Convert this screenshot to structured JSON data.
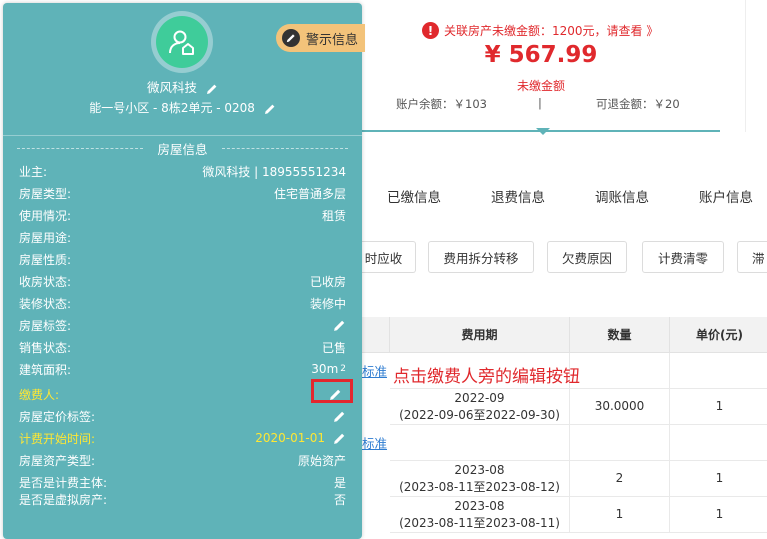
{
  "summary": {
    "notice": "关联房产未缴金额：1200元，请查看 》",
    "amount": "¥ 567.99",
    "amount_label": "未缴金额",
    "balance": "账户余额：￥103",
    "separator": "|",
    "refundable": "可退金额：￥20"
  },
  "tabs": [
    "已缴信息",
    "退费信息",
    "调账信息",
    "账户信息"
  ],
  "buttons": [
    "时应收",
    "费用拆分转移",
    "欠费原因",
    "计费清零",
    "滞"
  ],
  "table": {
    "headers": [
      "费用期",
      "数量",
      "单价(元)"
    ],
    "link_text": "标准",
    "rows": [
      {
        "period": "2022-09",
        "range": "(2022-09-06至2022-09-30)",
        "qty": "30.0000",
        "price": "1"
      },
      {
        "period": "2023-08",
        "range": "(2023-08-11至2023-08-12)",
        "qty": "2",
        "price": "1"
      },
      {
        "period": "2023-08",
        "range": "(2023-08-11至2023-08-11)",
        "qty": "1",
        "price": "1"
      }
    ]
  },
  "annotation": "点击缴费人旁的编辑按钮",
  "panel": {
    "owner": "微风科技",
    "address": "能一号小区 - 8栋2单元 - 0208",
    "warn_label": "警示信息",
    "section_title": "房屋信息",
    "fields": [
      {
        "label": "业主:",
        "value": "微风科技 | 18955551234"
      },
      {
        "label": "房屋类型:",
        "value": "住宅普通多层"
      },
      {
        "label": "使用情况:",
        "value": "租赁"
      },
      {
        "label": "房屋用途:",
        "value": ""
      },
      {
        "label": "房屋性质:",
        "value": ""
      },
      {
        "label": "收房状态:",
        "value": "已收房"
      },
      {
        "label": "装修状态:",
        "value": "装修中"
      },
      {
        "label": "房屋标签:",
        "value": ""
      },
      {
        "label": "销售状态:",
        "value": "已售"
      },
      {
        "label": "建筑面积:",
        "value": "30m",
        "sup": "2"
      },
      {
        "label": "缴费人:",
        "value": ""
      },
      {
        "label": "房屋定价标签:",
        "value": ""
      },
      {
        "label": "计费开始时间:",
        "value": "2020-01-01"
      },
      {
        "label": "房屋资产类型:",
        "value": "原始资产"
      },
      {
        "label": "是否是计费主体:",
        "value": "是"
      },
      {
        "label": "是否是虚拟房产:",
        "value": "否"
      }
    ]
  },
  "colors": {
    "panel": "#5fb3b8",
    "accent_red": "#e0292d",
    "highlight_yellow": "#ffe733",
    "warn_tag": "#f3c37a",
    "avatar": "#3fcc9a"
  }
}
